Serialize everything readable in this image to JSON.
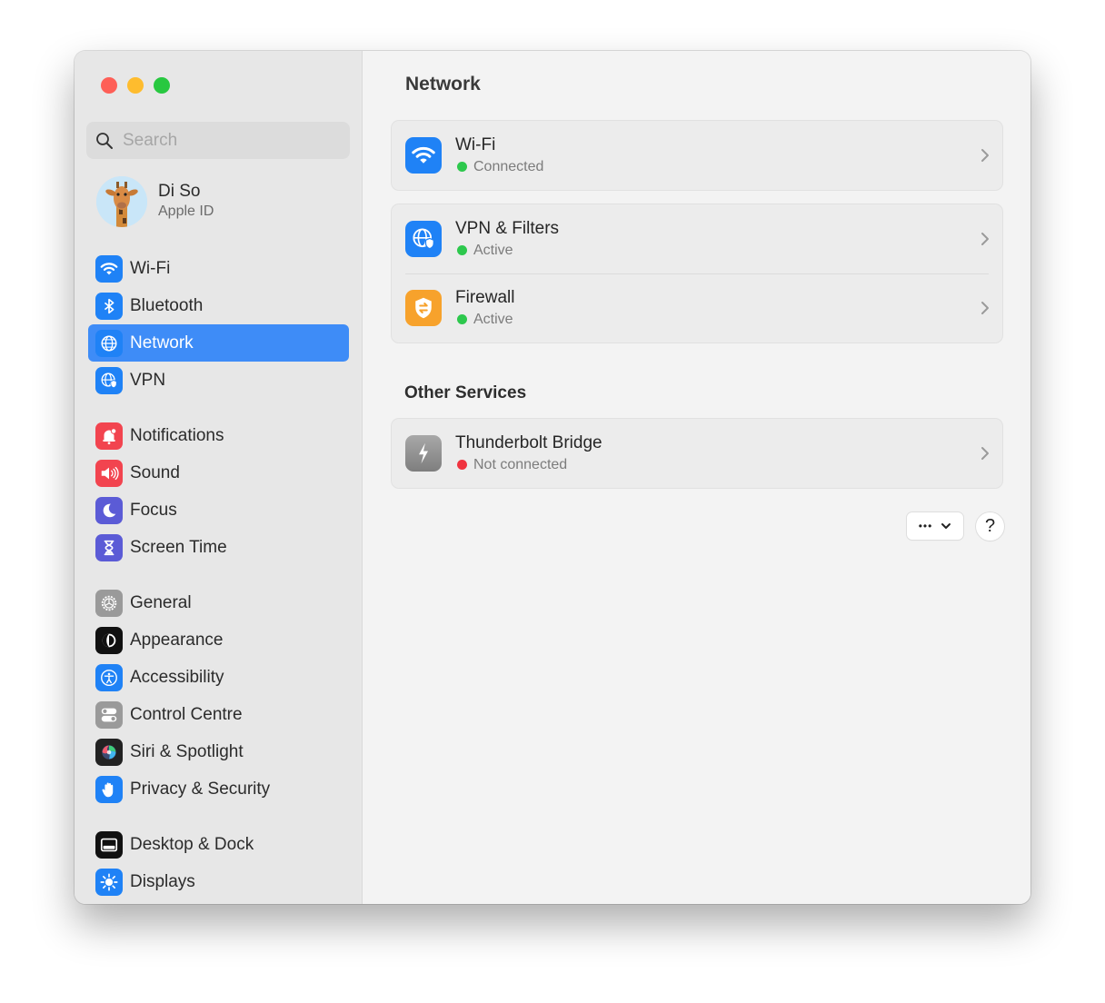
{
  "window": {
    "traffic_lights": [
      "close",
      "minimize",
      "zoom"
    ]
  },
  "sidebar": {
    "search": {
      "placeholder": "Search",
      "value": ""
    },
    "account": {
      "name": "Di So",
      "subtitle": "Apple ID",
      "avatar": "giraffe-avatar"
    },
    "groups": [
      [
        {
          "label": "Wi-Fi",
          "icon": "wifi-icon",
          "color": "#1f82f6"
        },
        {
          "label": "Bluetooth",
          "icon": "bluetooth-icon",
          "color": "#1f82f6"
        },
        {
          "label": "Network",
          "icon": "globe-icon",
          "color": "#1f82f6",
          "active": true
        },
        {
          "label": "VPN",
          "icon": "vpn-globe-shield-icon",
          "color": "#1f82f6"
        }
      ],
      [
        {
          "label": "Notifications",
          "icon": "bell-icon",
          "color": "#f2444f"
        },
        {
          "label": "Sound",
          "icon": "speaker-icon",
          "color": "#f2444f"
        },
        {
          "label": "Focus",
          "icon": "moon-icon",
          "color": "#5b5bd6"
        },
        {
          "label": "Screen Time",
          "icon": "hourglass-icon",
          "color": "#5b5bd6"
        }
      ],
      [
        {
          "label": "General",
          "icon": "gear-icon",
          "color": "#9a9a9a"
        },
        {
          "label": "Appearance",
          "icon": "appearance-icon",
          "color": "#111111"
        },
        {
          "label": "Accessibility",
          "icon": "accessibility-icon",
          "color": "#1f82f6"
        },
        {
          "label": "Control Centre",
          "icon": "toggles-icon",
          "color": "#9a9a9a"
        },
        {
          "label": "Siri & Spotlight",
          "icon": "siri-icon",
          "color": "#222222"
        },
        {
          "label": "Privacy & Security",
          "icon": "hand-icon",
          "color": "#1f82f6"
        }
      ],
      [
        {
          "label": "Desktop & Dock",
          "icon": "dock-icon",
          "color": "#111111"
        },
        {
          "label": "Displays",
          "icon": "sun-icon",
          "color": "#1f82f6"
        }
      ]
    ]
  },
  "main": {
    "title": "Network",
    "cards": [
      [
        {
          "title": "Wi-Fi",
          "status": "Connected",
          "status_color": "#2dc84d",
          "icon": "wifi-icon",
          "icon_color": "#1f82f6"
        }
      ],
      [
        {
          "title": "VPN & Filters",
          "status": "Active",
          "status_color": "#2dc84d",
          "icon": "vpn-globe-shield-icon",
          "icon_color": "#1f82f6"
        },
        {
          "title": "Firewall",
          "status": "Active",
          "status_color": "#2dc84d",
          "icon": "firewall-shield-icon",
          "icon_color": "#f7a22c"
        }
      ]
    ],
    "other_services_title": "Other Services",
    "other_services": [
      {
        "title": "Thunderbolt Bridge",
        "status": "Not connected",
        "status_color": "#f0333f",
        "icon": "thunderbolt-icon",
        "icon_color": "#8e8e8e"
      }
    ],
    "more_button": {
      "label": "•••",
      "icon": "chevron-down-icon"
    },
    "help_button": {
      "label": "?"
    }
  }
}
